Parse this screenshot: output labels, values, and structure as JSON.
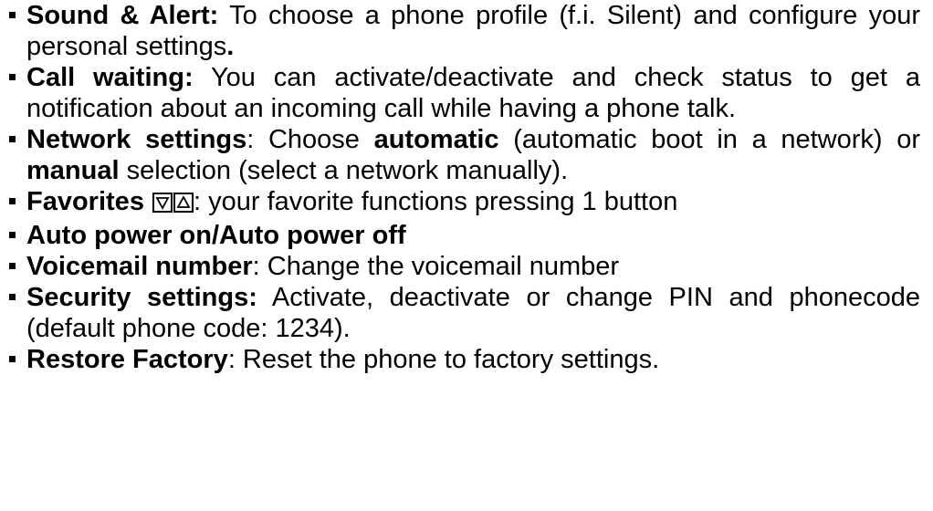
{
  "items": [
    {
      "title": "Sound & Alert:",
      "text": " To choose a phone profile (f.i. Silent) and configure your personal settings",
      "end": "."
    },
    {
      "title": "Call waiting:",
      "text": " You can activate/deactivate and check status to get a notification about an incoming call while having a phone talk."
    },
    {
      "title": "Network settings",
      "text1": ": Choose ",
      "bold1": "automatic",
      "text2": " (automatic boot in a network) or ",
      "bold2": "manual",
      "text3": " selection (select a network manually)."
    },
    {
      "title": "Favorites ",
      "icons": [
        "down-triangle-key",
        "up-triangle-key"
      ],
      "text": ": your favorite functions pressing 1 button"
    },
    {
      "title": "Auto power on/Auto power off"
    },
    {
      "title": "Voicemail number",
      "text": ": Change the voicemail number"
    },
    {
      "title": "Security settings:",
      "text": " Activate, deactivate or change PIN and phonecode (default phone code: 1234)."
    },
    {
      "title": "Restore Factory",
      "text": ": Reset the phone to factory settings."
    }
  ]
}
